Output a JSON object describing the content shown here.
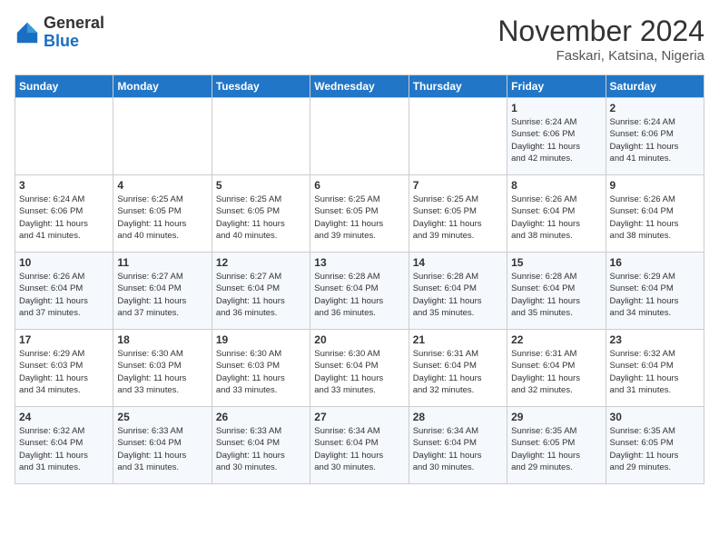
{
  "logo": {
    "general": "General",
    "blue": "Blue"
  },
  "header": {
    "month_year": "November 2024",
    "location": "Faskari, Katsina, Nigeria"
  },
  "weekdays": [
    "Sunday",
    "Monday",
    "Tuesday",
    "Wednesday",
    "Thursday",
    "Friday",
    "Saturday"
  ],
  "weeks": [
    [
      {
        "day": "",
        "info": ""
      },
      {
        "day": "",
        "info": ""
      },
      {
        "day": "",
        "info": ""
      },
      {
        "day": "",
        "info": ""
      },
      {
        "day": "",
        "info": ""
      },
      {
        "day": "1",
        "info": "Sunrise: 6:24 AM\nSunset: 6:06 PM\nDaylight: 11 hours\nand 42 minutes."
      },
      {
        "day": "2",
        "info": "Sunrise: 6:24 AM\nSunset: 6:06 PM\nDaylight: 11 hours\nand 41 minutes."
      }
    ],
    [
      {
        "day": "3",
        "info": "Sunrise: 6:24 AM\nSunset: 6:06 PM\nDaylight: 11 hours\nand 41 minutes."
      },
      {
        "day": "4",
        "info": "Sunrise: 6:25 AM\nSunset: 6:05 PM\nDaylight: 11 hours\nand 40 minutes."
      },
      {
        "day": "5",
        "info": "Sunrise: 6:25 AM\nSunset: 6:05 PM\nDaylight: 11 hours\nand 40 minutes."
      },
      {
        "day": "6",
        "info": "Sunrise: 6:25 AM\nSunset: 6:05 PM\nDaylight: 11 hours\nand 39 minutes."
      },
      {
        "day": "7",
        "info": "Sunrise: 6:25 AM\nSunset: 6:05 PM\nDaylight: 11 hours\nand 39 minutes."
      },
      {
        "day": "8",
        "info": "Sunrise: 6:26 AM\nSunset: 6:04 PM\nDaylight: 11 hours\nand 38 minutes."
      },
      {
        "day": "9",
        "info": "Sunrise: 6:26 AM\nSunset: 6:04 PM\nDaylight: 11 hours\nand 38 minutes."
      }
    ],
    [
      {
        "day": "10",
        "info": "Sunrise: 6:26 AM\nSunset: 6:04 PM\nDaylight: 11 hours\nand 37 minutes."
      },
      {
        "day": "11",
        "info": "Sunrise: 6:27 AM\nSunset: 6:04 PM\nDaylight: 11 hours\nand 37 minutes."
      },
      {
        "day": "12",
        "info": "Sunrise: 6:27 AM\nSunset: 6:04 PM\nDaylight: 11 hours\nand 36 minutes."
      },
      {
        "day": "13",
        "info": "Sunrise: 6:28 AM\nSunset: 6:04 PM\nDaylight: 11 hours\nand 36 minutes."
      },
      {
        "day": "14",
        "info": "Sunrise: 6:28 AM\nSunset: 6:04 PM\nDaylight: 11 hours\nand 35 minutes."
      },
      {
        "day": "15",
        "info": "Sunrise: 6:28 AM\nSunset: 6:04 PM\nDaylight: 11 hours\nand 35 minutes."
      },
      {
        "day": "16",
        "info": "Sunrise: 6:29 AM\nSunset: 6:04 PM\nDaylight: 11 hours\nand 34 minutes."
      }
    ],
    [
      {
        "day": "17",
        "info": "Sunrise: 6:29 AM\nSunset: 6:03 PM\nDaylight: 11 hours\nand 34 minutes."
      },
      {
        "day": "18",
        "info": "Sunrise: 6:30 AM\nSunset: 6:03 PM\nDaylight: 11 hours\nand 33 minutes."
      },
      {
        "day": "19",
        "info": "Sunrise: 6:30 AM\nSunset: 6:03 PM\nDaylight: 11 hours\nand 33 minutes."
      },
      {
        "day": "20",
        "info": "Sunrise: 6:30 AM\nSunset: 6:04 PM\nDaylight: 11 hours\nand 33 minutes."
      },
      {
        "day": "21",
        "info": "Sunrise: 6:31 AM\nSunset: 6:04 PM\nDaylight: 11 hours\nand 32 minutes."
      },
      {
        "day": "22",
        "info": "Sunrise: 6:31 AM\nSunset: 6:04 PM\nDaylight: 11 hours\nand 32 minutes."
      },
      {
        "day": "23",
        "info": "Sunrise: 6:32 AM\nSunset: 6:04 PM\nDaylight: 11 hours\nand 31 minutes."
      }
    ],
    [
      {
        "day": "24",
        "info": "Sunrise: 6:32 AM\nSunset: 6:04 PM\nDaylight: 11 hours\nand 31 minutes."
      },
      {
        "day": "25",
        "info": "Sunrise: 6:33 AM\nSunset: 6:04 PM\nDaylight: 11 hours\nand 31 minutes."
      },
      {
        "day": "26",
        "info": "Sunrise: 6:33 AM\nSunset: 6:04 PM\nDaylight: 11 hours\nand 30 minutes."
      },
      {
        "day": "27",
        "info": "Sunrise: 6:34 AM\nSunset: 6:04 PM\nDaylight: 11 hours\nand 30 minutes."
      },
      {
        "day": "28",
        "info": "Sunrise: 6:34 AM\nSunset: 6:04 PM\nDaylight: 11 hours\nand 30 minutes."
      },
      {
        "day": "29",
        "info": "Sunrise: 6:35 AM\nSunset: 6:05 PM\nDaylight: 11 hours\nand 29 minutes."
      },
      {
        "day": "30",
        "info": "Sunrise: 6:35 AM\nSunset: 6:05 PM\nDaylight: 11 hours\nand 29 minutes."
      }
    ]
  ]
}
